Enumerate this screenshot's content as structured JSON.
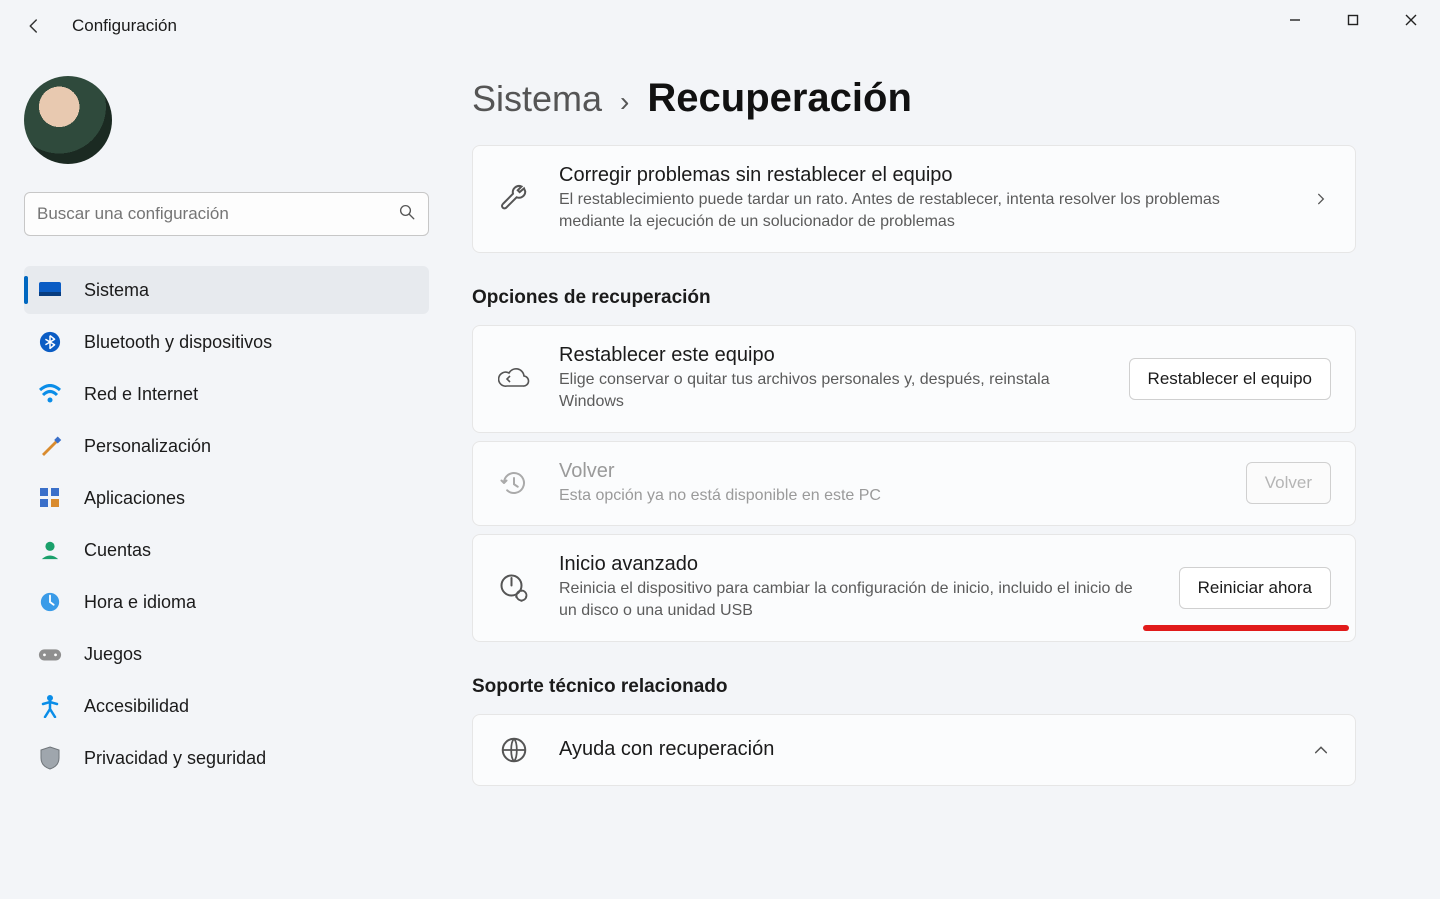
{
  "app": {
    "title": "Configuración"
  },
  "search": {
    "placeholder": "Buscar una configuración"
  },
  "nav": {
    "items": [
      {
        "label": "Sistema"
      },
      {
        "label": "Bluetooth y dispositivos"
      },
      {
        "label": "Red e Internet"
      },
      {
        "label": "Personalización"
      },
      {
        "label": "Aplicaciones"
      },
      {
        "label": "Cuentas"
      },
      {
        "label": "Hora e idioma"
      },
      {
        "label": "Juegos"
      },
      {
        "label": "Accesibilidad"
      },
      {
        "label": "Privacidad y seguridad"
      }
    ]
  },
  "breadcrumb": {
    "parent": "Sistema",
    "current": "Recuperación"
  },
  "cards": {
    "troubleshoot": {
      "title": "Corregir problemas sin restablecer el equipo",
      "desc": "El restablecimiento puede tardar un rato. Antes de restablecer, intenta resolver los problemas mediante la ejecución de un solucionador de problemas"
    },
    "reset": {
      "title": "Restablecer este equipo",
      "desc": "Elige conservar o quitar tus archivos personales y, después, reinstala Windows",
      "button": "Restablecer el equipo"
    },
    "goback": {
      "title": "Volver",
      "desc": "Esta opción ya no está disponible en este PC",
      "button": "Volver"
    },
    "advanced": {
      "title": "Inicio avanzado",
      "desc": "Reinicia el dispositivo para cambiar la configuración de inicio, incluido el inicio de un disco o una unidad USB",
      "button": "Reiniciar ahora"
    },
    "help": {
      "title": "Ayuda con recuperación"
    }
  },
  "sections": {
    "recovery_options": "Opciones de recuperación",
    "related_support": "Soporte técnico relacionado"
  }
}
